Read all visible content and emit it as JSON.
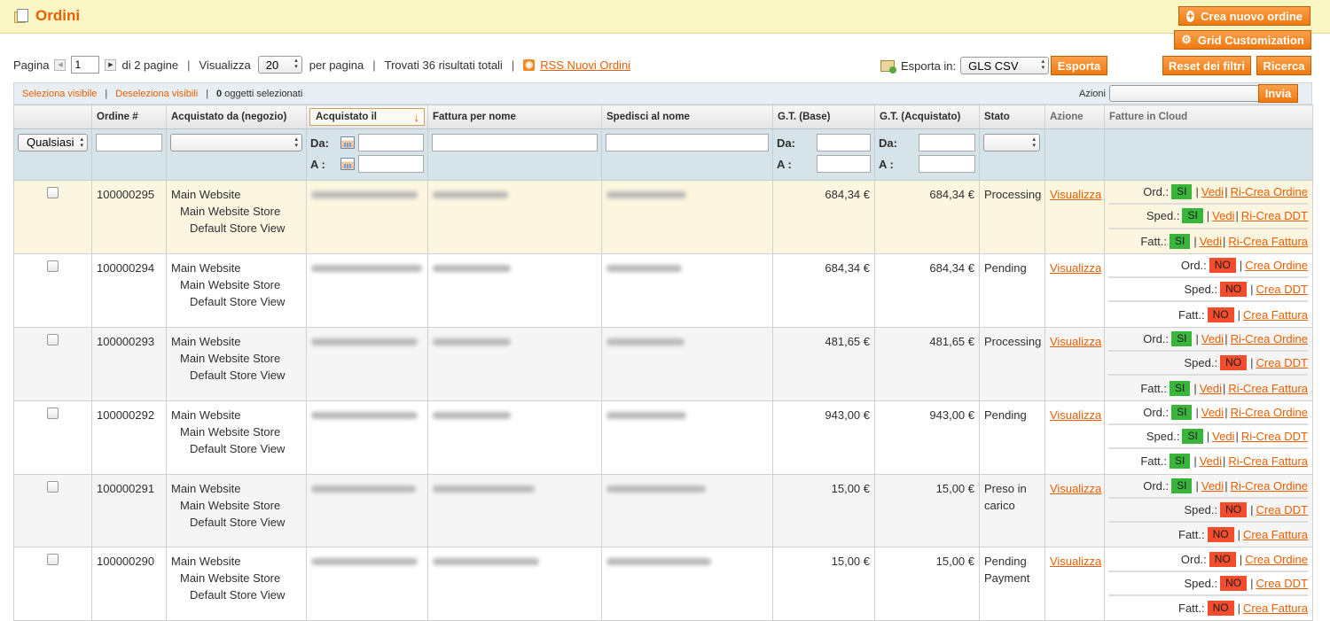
{
  "header": {
    "title": "Ordini",
    "new_order_label": "Crea nuovo ordine",
    "grid_customization_label": "Grid Customization"
  },
  "pager": {
    "page_label": "Pagina",
    "page_value": "1",
    "of_pages": "di 2 pagine",
    "view_label": "Visualizza",
    "per_page_value": "20",
    "per_page_label": "per pagina",
    "found": "Trovati 36 risultati totali",
    "rss_label": "RSS Nuovi Ordini"
  },
  "export": {
    "label": "Esporta in:",
    "format": "GLS CSV",
    "button": "Esporta",
    "reset_button": "Reset dei filtri",
    "search_button": "Ricerca"
  },
  "massaction": {
    "select_visible": "Seleziona visibile",
    "deselect_visible": "Deseleziona visibili",
    "selected_count": "0",
    "selected_label": "oggetti selezionati",
    "actions_label": "Azioni",
    "actions_value": "",
    "submit_label": "Invia"
  },
  "columns": [
    "",
    "Ordine #",
    "Acquistato da (negozio)",
    "Acquistato il",
    "Fattura per nome",
    "Spedisci al nome",
    "G.T. (Base)",
    "G.T. (Acquistato)",
    "Stato",
    "Azione",
    "Fatture in Cloud"
  ],
  "filters": {
    "any_label": "Qualsiasi",
    "from_label": "Da:",
    "to_label": "A :"
  },
  "row_labels": {
    "website": "Main Website",
    "store": "Main Website Store",
    "store_view": "Default Store View",
    "view_action": "Visualizza",
    "ord": "Ord.:",
    "sped": "Sped.:",
    "fatt": "Fatt.:",
    "yes": "SI",
    "no": "NO",
    "vedi": "Vedi",
    "recreate_order": "Ri-Crea Ordine",
    "recreate_ddt": "Ri-Crea DDT",
    "recreate_invoice": "Ri-Crea Fattura",
    "create_order": "Crea Ordine",
    "create_ddt": "Crea DDT",
    "create_invoice": "Crea Fattura"
  },
  "orders": [
    {
      "id": "100000295",
      "gt_base": "684,34 €",
      "gt_purchased": "684,34 €",
      "status": "Processing",
      "ord": true,
      "sped": true,
      "fatt": true
    },
    {
      "id": "100000294",
      "gt_base": "684,34 €",
      "gt_purchased": "684,34 €",
      "status": "Pending",
      "ord": false,
      "sped": false,
      "fatt": false
    },
    {
      "id": "100000293",
      "gt_base": "481,65 €",
      "gt_purchased": "481,65 €",
      "status": "Processing",
      "ord": true,
      "sped": false,
      "fatt": true
    },
    {
      "id": "100000292",
      "gt_base": "943,00 €",
      "gt_purchased": "943,00 €",
      "status": "Pending",
      "ord": true,
      "sped": true,
      "fatt": true
    },
    {
      "id": "100000291",
      "gt_base": "15,00 €",
      "gt_purchased": "15,00 €",
      "status": "Preso in carico",
      "ord": true,
      "sped": false,
      "fatt": false
    },
    {
      "id": "100000290",
      "gt_base": "15,00 €",
      "gt_purchased": "15,00 €",
      "status": "Pending Payment",
      "ord": false,
      "sped": false,
      "fatt": false
    }
  ],
  "colors": {
    "accent": "#eb5e00",
    "button": "#f08419",
    "header_bg": "#fbf7c4",
    "filter_bg": "#d6e3e9",
    "badge_yes": "#39b53b",
    "badge_no": "#f44d2d"
  }
}
